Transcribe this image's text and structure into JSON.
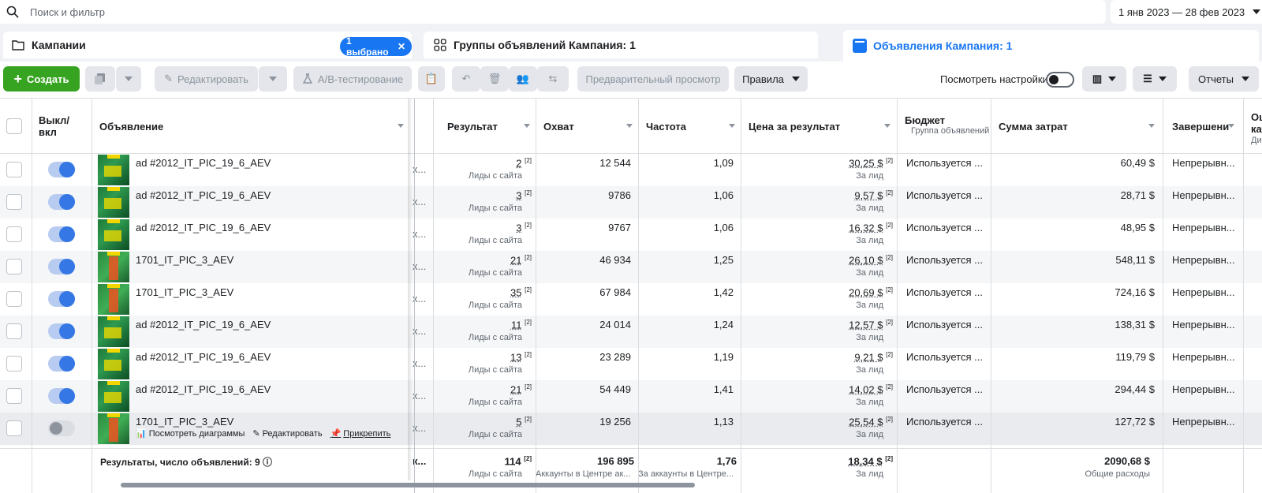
{
  "search": {
    "placeholder": "Поиск и фильтр"
  },
  "date_range": "1 янв 2023 — 28 фев 2023",
  "tabs": {
    "campaigns": {
      "label": "Кампании",
      "selected": "1 выбрано"
    },
    "adsets": {
      "label": "Группы объявлений Кампания: 1"
    },
    "ads": {
      "label": "Объявления Кампания: 1"
    }
  },
  "toolbar": {
    "create": "Создать",
    "edit": "Редактировать",
    "ab_test": "A/B-тестирование",
    "preview": "Предварительный просмотр",
    "rules": "Правила",
    "view_settings": "Посмотреть настройки",
    "reports": "Отчеты"
  },
  "columns": {
    "toggle": "Выкл/ вкл",
    "ad": "Объявление",
    "result": "Результат",
    "reach": "Охват",
    "frequency": "Частота",
    "cost_per_result": "Цена за результат",
    "budget": "Бюджет",
    "budget_sub": "Группа объявлений",
    "spend": "Сумма затрат",
    "end": "Завершени",
    "extra": "Оц",
    "extra2": "кач",
    "extra3": "Ди"
  },
  "rows": [
    {
      "name": "ad #2012_IT_PIC_19_6_AEV",
      "result": "2",
      "result_sub": "Лиды с сайта",
      "reach": "12 544",
      "freq": "1,09",
      "cpr": "30,25 $",
      "cpr_sub": "За лид",
      "budget": "Используется ...",
      "spend": "60,49 $",
      "end": "Непрерывн...",
      "on": true
    },
    {
      "name": "ad #2012_IT_PIC_19_6_AEV",
      "result": "3",
      "result_sub": "Лиды с сайта",
      "reach": "9786",
      "freq": "1,06",
      "cpr": "9,57 $",
      "cpr_sub": "За лид",
      "budget": "Используется ...",
      "spend": "28,71 $",
      "end": "Непрерывн...",
      "on": true
    },
    {
      "name": "ad #2012_IT_PIC_19_6_AEV",
      "result": "3",
      "result_sub": "Лиды с сайта",
      "reach": "9767",
      "freq": "1,06",
      "cpr": "16,32 $",
      "cpr_sub": "За лид",
      "budget": "Используется ...",
      "spend": "48,95 $",
      "end": "Непрерывн...",
      "on": true
    },
    {
      "name": "1701_IT_PIC_3_AEV",
      "result": "21",
      "result_sub": "Лиды с сайта",
      "reach": "46 934",
      "freq": "1,25",
      "cpr": "26,10 $",
      "cpr_sub": "За лид",
      "budget": "Используется ...",
      "spend": "548,11 $",
      "end": "Непрерывн...",
      "on": true
    },
    {
      "name": "1701_IT_PIC_3_AEV",
      "result": "35",
      "result_sub": "Лиды с сайта",
      "reach": "67 984",
      "freq": "1,42",
      "cpr": "20,69 $",
      "cpr_sub": "За лид",
      "budget": "Используется ...",
      "spend": "724,16 $",
      "end": "Непрерывн...",
      "on": true
    },
    {
      "name": "ad #2012_IT_PIC_19_6_AEV",
      "result": "11",
      "result_sub": "Лиды с сайта",
      "reach": "24 014",
      "freq": "1,24",
      "cpr": "12,57 $",
      "cpr_sub": "За лид",
      "budget": "Используется ...",
      "spend": "138,31 $",
      "end": "Непрерывн...",
      "on": true
    },
    {
      "name": "ad #2012_IT_PIC_19_6_AEV",
      "result": "13",
      "result_sub": "Лиды с сайта",
      "reach": "23 289",
      "freq": "1,19",
      "cpr": "9,21 $",
      "cpr_sub": "За лид",
      "budget": "Используется ...",
      "spend": "119,79 $",
      "end": "Непрерывн...",
      "on": true
    },
    {
      "name": "ad #2012_IT_PIC_19_6_AEV",
      "result": "21",
      "result_sub": "Лиды с сайта",
      "reach": "54 449",
      "freq": "1,41",
      "cpr": "14,02 $",
      "cpr_sub": "За лид",
      "budget": "Используется ...",
      "spend": "294,44 $",
      "end": "Непрерывн...",
      "on": true
    },
    {
      "name": "1701_IT_PIC_3_AEV",
      "result": "5",
      "result_sub": "Лиды с сайта",
      "reach": "19 256",
      "freq": "1,13",
      "cpr": "25,54 $",
      "cpr_sub": "За лид",
      "budget": "Используется ...",
      "spend": "127,72 $",
      "end": "Непрерывн...",
      "on": false
    }
  ],
  "hover_links": {
    "charts": "Посмотреть диаграммы",
    "edit": "Редактировать",
    "pin": "Прикрепить"
  },
  "totals": {
    "label": "Результаты, число объявлений: 9",
    "result": "114",
    "result_sub": "Лиды с сайта",
    "reach": "196 895",
    "reach_sub": "Аккаунты в Центре ак...",
    "freq": "1,76",
    "freq_sub": "За аккаунты в Центре...",
    "cpr": "18,34 $",
    "cpr_sub": "За лид",
    "spend": "2090,68 $",
    "spend_sub": "Общие расходы"
  },
  "footnote": "[2]",
  "truncated_cell": "x...",
  "truncated_total": "к...",
  "colors": {
    "accent": "#1876f2",
    "create": "#36a420"
  }
}
